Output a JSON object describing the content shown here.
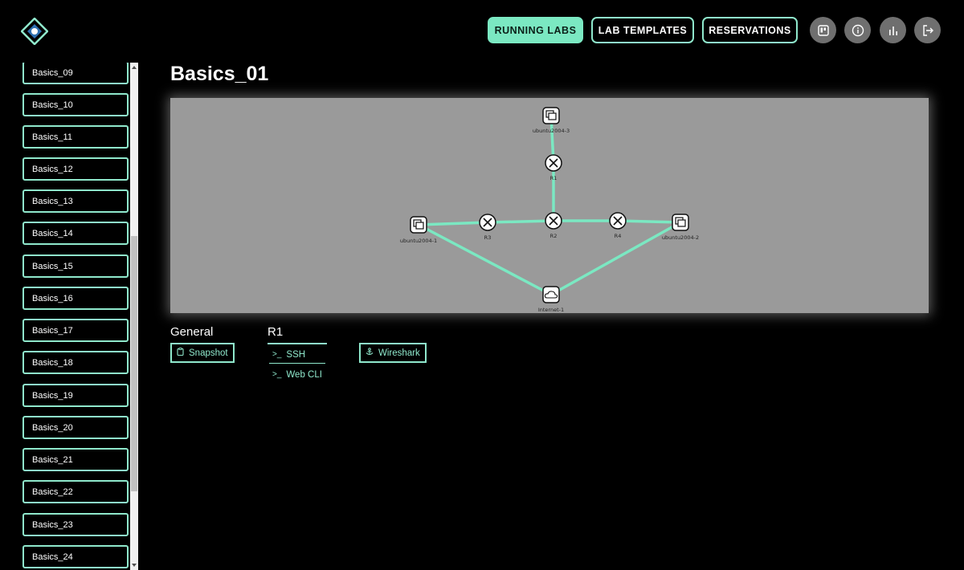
{
  "header": {
    "nav": [
      {
        "label": "RUNNING LABS",
        "active": true
      },
      {
        "label": "LAB TEMPLATES",
        "active": false
      },
      {
        "label": "RESERVATIONS",
        "active": false
      }
    ],
    "icons": [
      "kanban-icon",
      "info-icon",
      "bar-chart-icon",
      "logout-icon"
    ]
  },
  "sidebar": {
    "items": [
      {
        "label": "Basics_09"
      },
      {
        "label": "Basics_10"
      },
      {
        "label": "Basics_11"
      },
      {
        "label": "Basics_12"
      },
      {
        "label": "Basics_13"
      },
      {
        "label": "Basics_14"
      },
      {
        "label": "Basics_15"
      },
      {
        "label": "Basics_16"
      },
      {
        "label": "Basics_17"
      },
      {
        "label": "Basics_18"
      },
      {
        "label": "Basics_19"
      },
      {
        "label": "Basics_20"
      },
      {
        "label": "Basics_21"
      },
      {
        "label": "Basics_22"
      },
      {
        "label": "Basics_23"
      },
      {
        "label": "Basics_24"
      }
    ]
  },
  "main": {
    "title": "Basics_01",
    "topology": {
      "nodes": {
        "ubuntu3": "ubuntu2004-3",
        "r1": "R1",
        "ubuntu1": "ubuntu2004-1",
        "r3": "R3",
        "r2": "R2",
        "r4": "R4",
        "ubuntu2": "ubuntu2004-2",
        "internet": "Internet-1"
      }
    },
    "general": {
      "label": "General",
      "snapshot_label": "Snapshot"
    },
    "node_panel": {
      "label": "R1",
      "ssh_label": "SSH",
      "webcli_label": "Web CLI",
      "wireshark_label": "Wireshark"
    }
  },
  "colors": {
    "accent": "#7be8c2",
    "link": "#7be8c2",
    "canvas": "#9a9a9a",
    "background": "#000000"
  }
}
